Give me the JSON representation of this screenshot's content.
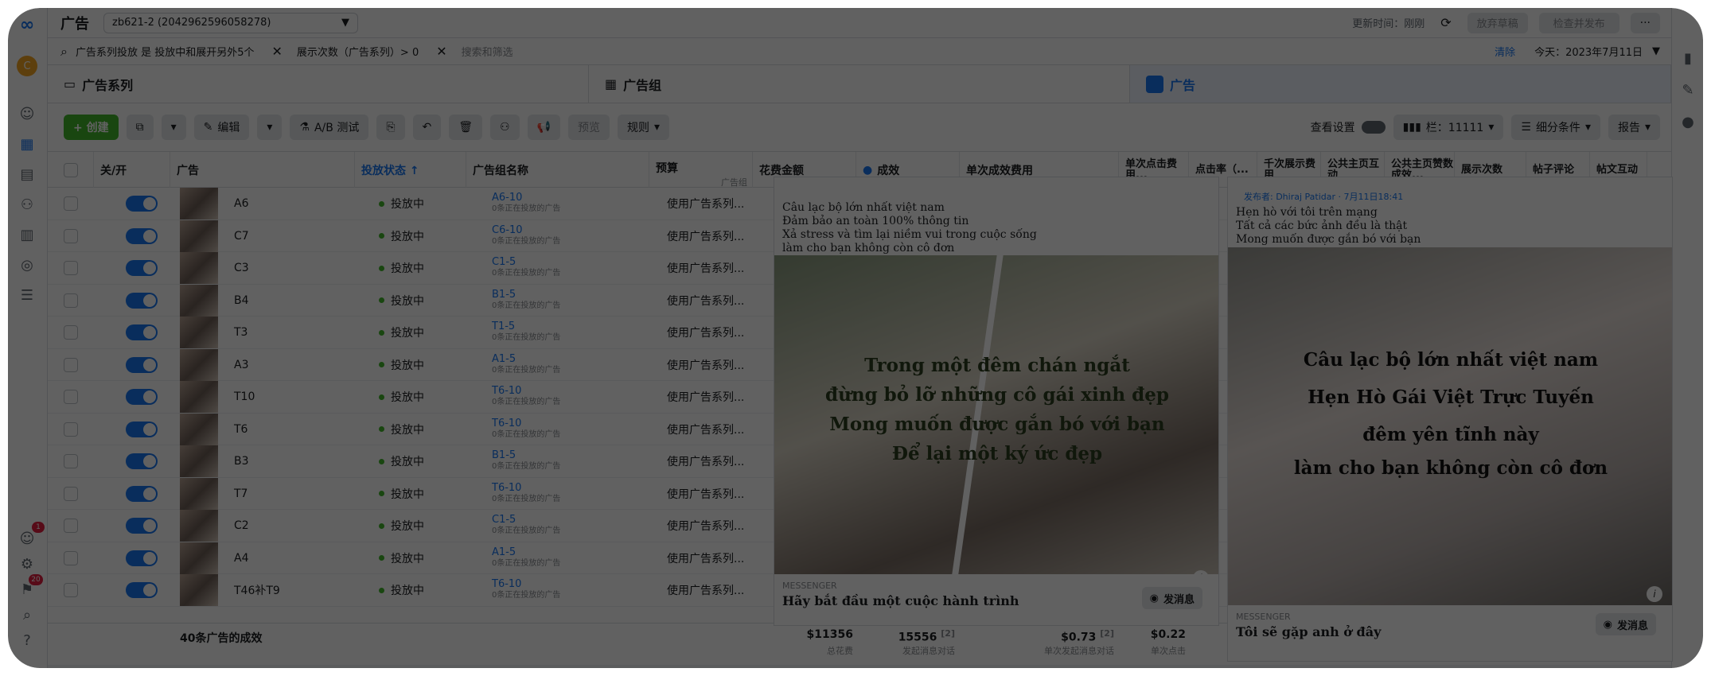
{
  "topbar": {
    "title": "广告",
    "account": "zb621-2 (2042962596058278)",
    "updated": "更新时间：刚刚",
    "discard": "放弃草稿",
    "review_publish": "检查并发布"
  },
  "filter": {
    "chip1": "广告系列投放 是 投放中和展开另外5个",
    "chip2": "展示次数（广告系列）> 0",
    "placeholder": "搜索和筛选",
    "clear": "清除",
    "date": "今天：2023年7月11日"
  },
  "levels": {
    "campaign": "广告系列",
    "adset": "广告组",
    "ad": "广告"
  },
  "toolbar": {
    "create": "+ 创建",
    "edit": "编辑",
    "abtest": "A/B 测试",
    "preview": "预览",
    "rules": "规则",
    "view_settings": "查看设置",
    "columns": "栏：11111",
    "breakdown": "细分条件",
    "reports": "报告"
  },
  "columns": {
    "onoff": "关/开",
    "ad": "广告",
    "delivery": "投放状态 ↑",
    "adset_name": "广告组名称",
    "budget": "预算",
    "budget_sub": "广告组",
    "spend": "花费金额",
    "results": "成效",
    "cost": "单次成效费用",
    "cpc": "单次点击费用...",
    "ctr": "点击率（...",
    "k_impr": "千次展示费用",
    "page_eng": "公共主页互动",
    "page_cost": "公共主页赞数成效...",
    "impr": "展示次数",
    "post_comments": "帖子评论",
    "post_eng": "帖文互动"
  },
  "rows": [
    {
      "name": "A6",
      "status": "投放中",
      "adset": "A6-10",
      "adset_sub": "0条正在投放的广告",
      "budget": "使用广告系列..."
    },
    {
      "name": "C7",
      "status": "投放中",
      "adset": "C6-10",
      "adset_sub": "0条正在投放的广告",
      "budget": "使用广告系列..."
    },
    {
      "name": "C3",
      "status": "投放中",
      "adset": "C1-5",
      "adset_sub": "0条正在投放的广告",
      "budget": "使用广告系列..."
    },
    {
      "name": "B4",
      "status": "投放中",
      "adset": "B1-5",
      "adset_sub": "0条正在投放的广告",
      "budget": "使用广告系列..."
    },
    {
      "name": "T3",
      "status": "投放中",
      "adset": "T1-5",
      "adset_sub": "0条正在投放的广告",
      "budget": "使用广告系列..."
    },
    {
      "name": "A3",
      "status": "投放中",
      "adset": "A1-5",
      "adset_sub": "0条正在投放的广告",
      "budget": "使用广告系列..."
    },
    {
      "name": "T10",
      "status": "投放中",
      "adset": "T6-10",
      "adset_sub": "0条正在投放的广告",
      "budget": "使用广告系列..."
    },
    {
      "name": "T6",
      "status": "投放中",
      "adset": "T6-10",
      "adset_sub": "0条正在投放的广告",
      "budget": "使用广告系列..."
    },
    {
      "name": "B3",
      "status": "投放中",
      "adset": "B1-5",
      "adset_sub": "0条正在投放的广告",
      "budget": "使用广告系列..."
    },
    {
      "name": "T7",
      "status": "投放中",
      "adset": "T6-10",
      "adset_sub": "0条正在投放的广告",
      "budget": "使用广告系列..."
    },
    {
      "name": "C2",
      "status": "投放中",
      "adset": "C1-5",
      "adset_sub": "0条正在投放的广告",
      "budget": "使用广告系列..."
    },
    {
      "name": "A4",
      "status": "投放中",
      "adset": "A1-5",
      "adset_sub": "0条正在投放的广告",
      "budget": "使用广告系列..."
    },
    {
      "name": "T46补T9",
      "status": "投放中",
      "adset": "T6-10",
      "adset_sub": "0条正在投放的广告",
      "budget": "使用广告系列..."
    }
  ],
  "footer": {
    "label": "40条广告的成效",
    "spend": "$11356",
    "spend_sub": "总花费",
    "results": "15556",
    "results_sup": "[2]",
    "results_sub": "发起消息对话",
    "cost": "$0.73",
    "cost_sup": "[2]",
    "cost_sub": "单次发起消息对话",
    "cpc": "$0.22",
    "cpc_sub": "单次点击"
  },
  "preview1": {
    "line1": "Câu lạc bộ lớn nhất việt nam",
    "line2": "Đảm bảo an toàn 100% thông tin",
    "line3": "Xả stress và tìm lại niềm vui trong cuộc sống",
    "line4": "làm cho bạn không còn cô đơn",
    "overlay": [
      "Trong một đêm chán ngắt",
      "đừng bỏ lỡ những cô gái xinh đẹp",
      "Mong muốn được gắn bó với bạn",
      "Để lại một ký ức đẹp"
    ],
    "platform": "MESSENGER",
    "headline": "Hãy bắt đầu một cuộc hành trình",
    "cta": "发消息"
  },
  "preview2": {
    "author": "发布者: Dhiraj Patidar · 7月11日18:41",
    "line1": "Hẹn hò với tôi trên mạng",
    "line2": "Tất cả các bức ảnh đều là thật",
    "line3": "Mong muốn được gắn bó với bạn",
    "overlay": [
      "Câu lạc bộ lớn nhất việt nam",
      "Hẹn Hò Gái Việt Trực Tuyến",
      "đêm yên tĩnh này",
      "làm cho bạn không còn cô đơn"
    ],
    "platform": "MESSENGER",
    "headline": "Tôi sẽ gặp anh ở đây",
    "cta": "发消息"
  },
  "left_rail": {
    "avatar": "C",
    "badge1": "1",
    "badge2": "20"
  }
}
